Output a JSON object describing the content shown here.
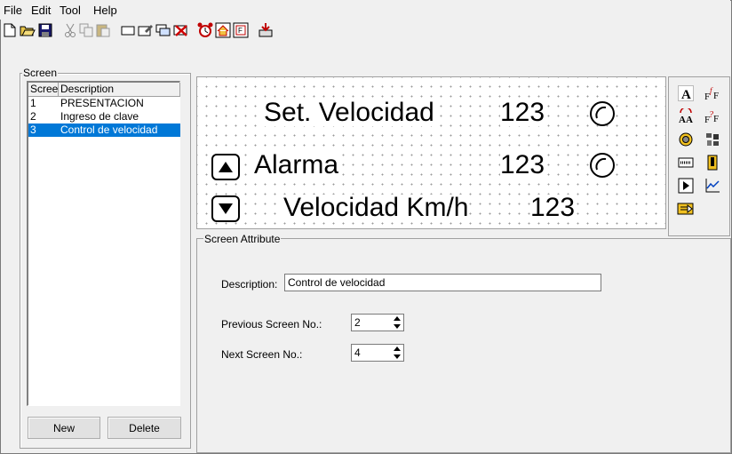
{
  "menu": [
    "File",
    "Edit",
    "Tool",
    "Help"
  ],
  "toolbar_icons": [
    "new-icon",
    "open-icon",
    "save-icon",
    "cut-icon",
    "copy-icon",
    "paste-icon",
    "screen-icon",
    "screen-props-icon",
    "screen-copy-icon",
    "delete-screen-icon",
    "alarm-icon",
    "home-icon",
    "function-icon",
    "download-icon"
  ],
  "screen_panel": {
    "title": "Screen",
    "columns": [
      "Scree",
      "Description"
    ],
    "rows": [
      {
        "no": "1",
        "description": "PRESENTACION"
      },
      {
        "no": "2",
        "description": "Ingreso de clave"
      },
      {
        "no": "3",
        "description": "Control de velocidad"
      }
    ],
    "selected_row": 2,
    "new_label": "New",
    "delete_label": "Delete"
  },
  "canvas": {
    "line1": "Set. Velocidad",
    "line1_value": "123",
    "line2": "Alarma",
    "line2_value": "123",
    "line3": "Velocidad Km/h",
    "line3_value": "123"
  },
  "palette_icons": [
    "text-icon",
    "formula-text-icon",
    "scroll-text-icon",
    "formula-scroll-icon",
    "lamp-icon",
    "bitmap-icon",
    "numeric-display-icon",
    "numeric-input-icon",
    "screen-jump-icon",
    "trend-icon",
    "function-key-icon"
  ],
  "palette_labels": {
    "text": "A",
    "formula": "F"
  },
  "attributes": {
    "title": "Screen Attribute",
    "description_label": "Description:",
    "description_value": "Control de velocidad",
    "prev_label": "Previous Screen No.:",
    "prev_value": "2",
    "next_label": "Next Screen No.:",
    "next_value": "4"
  },
  "colors": {
    "selection": "#0078d7",
    "background": "#f0f0f0"
  }
}
